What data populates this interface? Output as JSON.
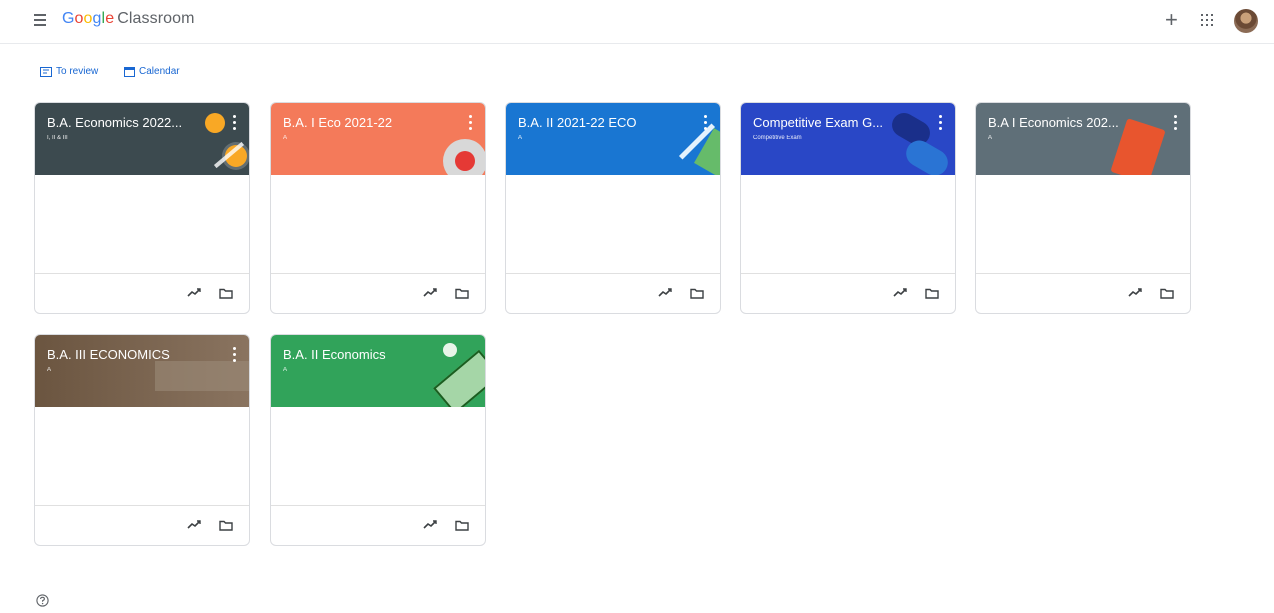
{
  "header": {
    "brand_letters": [
      "G",
      "o",
      "o",
      "g",
      "l",
      "e"
    ],
    "app_name": "Classroom",
    "icons": [
      "menu-icon",
      "plus-icon",
      "apps-grid-icon",
      "avatar"
    ]
  },
  "subnav": {
    "to_review_label": "To review",
    "calendar_label": "Calendar",
    "icons": [
      "to-review-icon",
      "calendar-icon"
    ]
  },
  "colors": {
    "accent_blue": "#1967d2",
    "card_header_1": "#3c4a4f",
    "card_header_2": "#f47a5a",
    "card_header_3": "#1976d2",
    "card_header_4": "#2947c6",
    "card_header_5": "#5f6f78",
    "card_header_6": "#6b5540",
    "card_header_7": "#31a35a"
  },
  "classes": [
    {
      "title": "B.A. Economics 2022...",
      "section": "I, II & III"
    },
    {
      "title": "B.A. I Eco 2021-22",
      "section": "A"
    },
    {
      "title": "B.A. II 2021-22 ECO",
      "section": "A"
    },
    {
      "title": "Competitive Exam G...",
      "section": "Competitive Exam"
    },
    {
      "title": "B.A I Economics 202...",
      "section": "A"
    },
    {
      "title": "B.A. III ECONOMICS",
      "section": "A"
    },
    {
      "title": "B.A. II Economics",
      "section": "A"
    }
  ],
  "card_icons": [
    "trending-icon",
    "folder-icon",
    "more-vert-icon"
  ],
  "footer": {
    "icon": "help-icon"
  }
}
